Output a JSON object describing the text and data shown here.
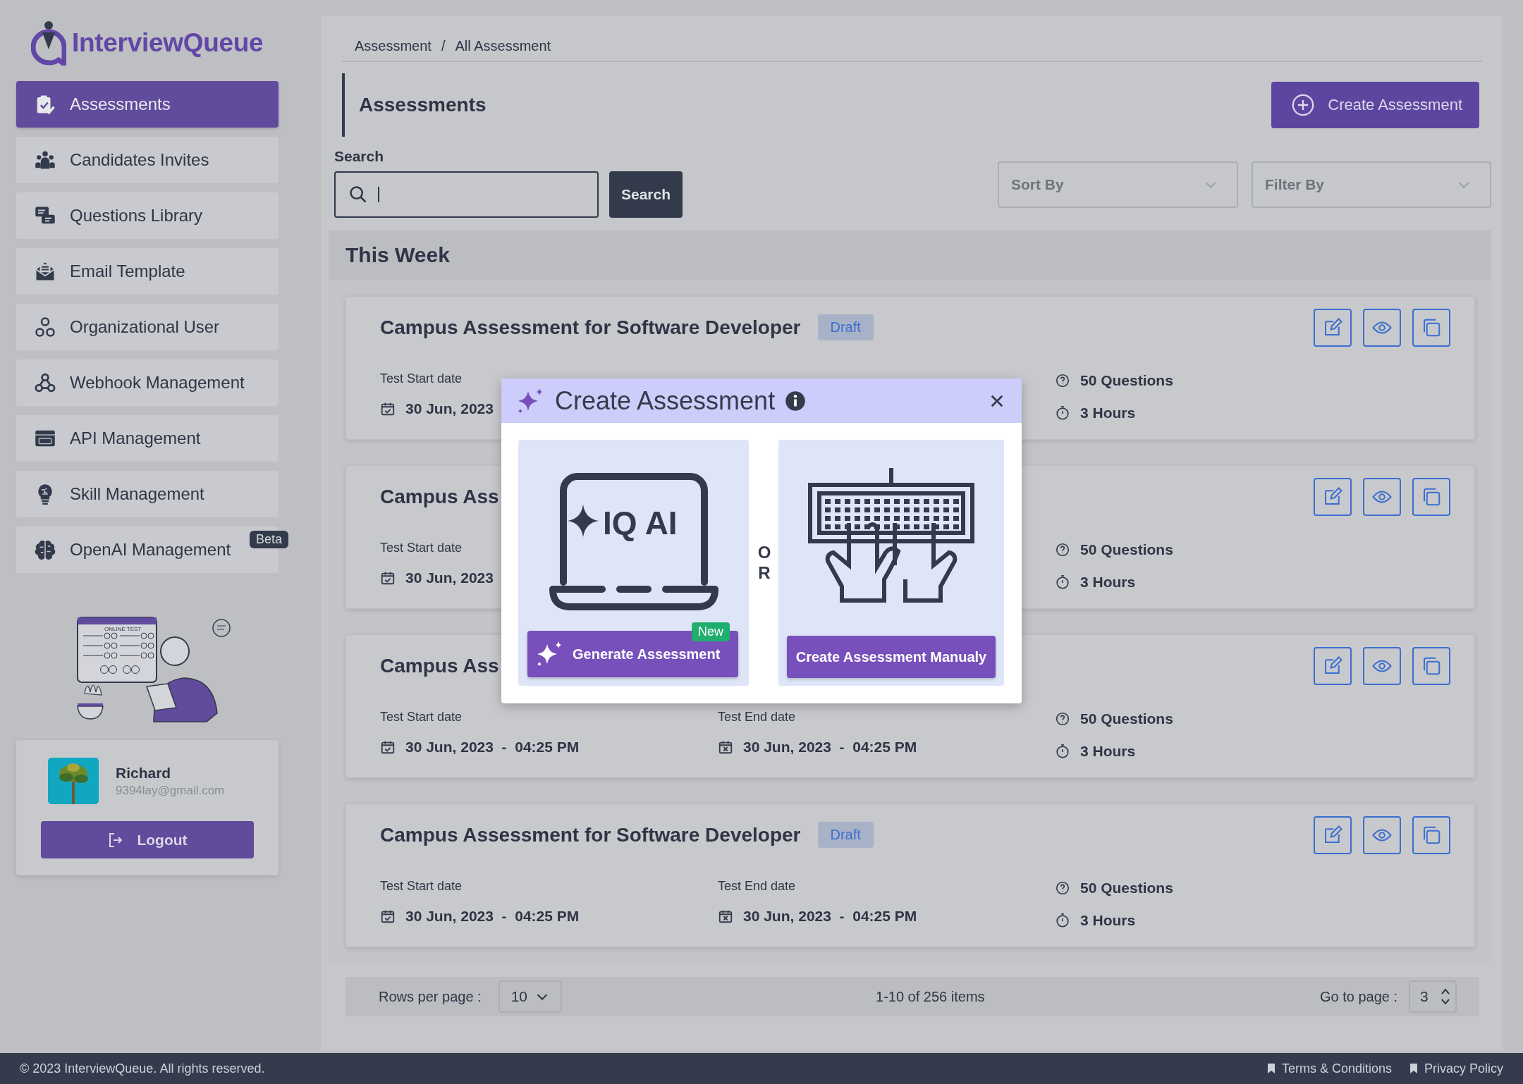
{
  "logo": {
    "text": "InterviewQueue"
  },
  "sidebar": {
    "items": [
      {
        "label": "Assessments",
        "selected": true
      },
      {
        "label": "Candidates Invites",
        "selected": false
      },
      {
        "label": "Questions Library",
        "selected": false
      },
      {
        "label": "Email Template",
        "selected": false
      },
      {
        "label": "Organizational User",
        "selected": false
      },
      {
        "label": "Webhook Management",
        "selected": false
      },
      {
        "label": "API Management",
        "selected": false
      },
      {
        "label": "Skill Management",
        "selected": false
      },
      {
        "label": "OpenAI Management",
        "selected": false,
        "badge": "Beta"
      }
    ]
  },
  "illustration": {
    "caption": "ONLINE TEST"
  },
  "user": {
    "name": "Richard",
    "email": "9394lay@gmail.com",
    "logout": "Logout"
  },
  "breadcrumb": {
    "items": [
      "Assessment",
      "All Assessment"
    ],
    "separator": "/"
  },
  "page_title": "Assessments",
  "create_button": "Create Assessment",
  "search": {
    "label": "Search",
    "button": "Search"
  },
  "sort": {
    "placeholder": "Sort By"
  },
  "filter": {
    "placeholder": "Filter By"
  },
  "section_title": "This Week",
  "cards": [
    {
      "title": "Campus Assessment for Software Developer",
      "status": "Draft",
      "start_label": "Test Start date",
      "start_value": "30 Jun, 2023",
      "questions": "50 Questions",
      "duration": "3 Hours"
    },
    {
      "title": "Campus Ass",
      "start_label": "Test Start date",
      "start_value": "30 Jun, 2023",
      "questions": "50 Questions",
      "duration": "3 Hours"
    },
    {
      "title": "Campus Ass",
      "start_label": "Test Start date",
      "start_value": "30 Jun, 2023  -  04:25 PM",
      "end_label": "Test End date",
      "end_value": "30 Jun, 2023  -  04:25 PM",
      "questions": "50 Questions",
      "duration": "3 Hours"
    },
    {
      "title": "Campus Assessment for Software Developer",
      "status": "Draft",
      "start_label": "Test Start date",
      "start_value": "30 Jun, 2023  -  04:25 PM",
      "end_label": "Test End date",
      "end_value": "30 Jun, 2023  -  04:25 PM",
      "questions": "50 Questions",
      "duration": "3 Hours"
    }
  ],
  "pagination": {
    "rows_label": "Rows per page :",
    "rows_value": "10",
    "summary": "1-10 of 256 items",
    "goto_label": "Go to page :",
    "goto_value": "3"
  },
  "modal": {
    "title": "Create Assessment",
    "separator": "OR",
    "options": [
      {
        "kind": "ai",
        "art_text": "IQ AI",
        "button": "Generate Assessment",
        "badge": "New"
      },
      {
        "kind": "manual",
        "button": "Create Assessment Manualy"
      }
    ]
  },
  "footer": {
    "copyright": "© 2023 InterviewQueue. All rights reserved.",
    "links": [
      "Terms & Conditions",
      "Privacy Policy"
    ]
  }
}
